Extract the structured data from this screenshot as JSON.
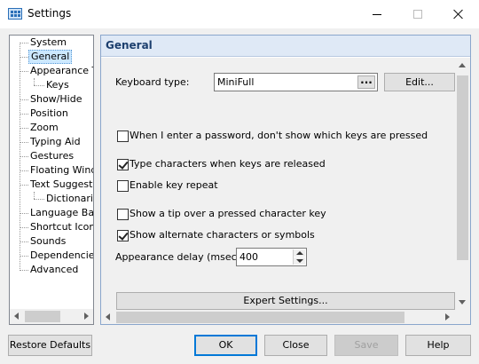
{
  "window": {
    "title": "Settings"
  },
  "tree": {
    "items": [
      {
        "label": "System"
      },
      {
        "label": "General"
      },
      {
        "label": "Appearance Th"
      },
      {
        "label": "Keys"
      },
      {
        "label": "Show/Hide"
      },
      {
        "label": "Position"
      },
      {
        "label": "Zoom"
      },
      {
        "label": "Typing Aid"
      },
      {
        "label": "Gestures"
      },
      {
        "label": "Floating Windo"
      },
      {
        "label": "Text Suggestio"
      },
      {
        "label": "Dictionaries"
      },
      {
        "label": "Language Bar"
      },
      {
        "label": "Shortcut Icons"
      },
      {
        "label": "Sounds"
      },
      {
        "label": "Dependencies"
      },
      {
        "label": "Advanced"
      }
    ],
    "selected": "General"
  },
  "panel": {
    "title": "General",
    "keyboard_type_label": "Keyboard type:",
    "keyboard_type_value": "MiniFull",
    "ellipsis_label": "...",
    "edit_label": "Edit...",
    "options": [
      {
        "label": "When I enter a password, don't show which keys are pressed",
        "checked": false
      },
      {
        "label": "Type characters when keys are released",
        "checked": true
      },
      {
        "label": "Enable key repeat",
        "checked": false
      },
      {
        "label": "Show a tip over a pressed character key",
        "checked": false
      },
      {
        "label": "Show alternate characters or symbols",
        "checked": true
      }
    ],
    "appearance_delay_label": "Appearance delay (msec):",
    "appearance_delay_value": "400",
    "expert_settings_label": "Expert Settings..."
  },
  "footer": {
    "restore_defaults": "Restore Defaults",
    "ok": "OK",
    "close": "Close",
    "save": "Save",
    "help": "Help"
  },
  "colors": {
    "accent": "#0078d7",
    "header_bg": "#dfe9f6",
    "header_text": "#1c3f6e",
    "selection_bg": "#cce8ff"
  }
}
